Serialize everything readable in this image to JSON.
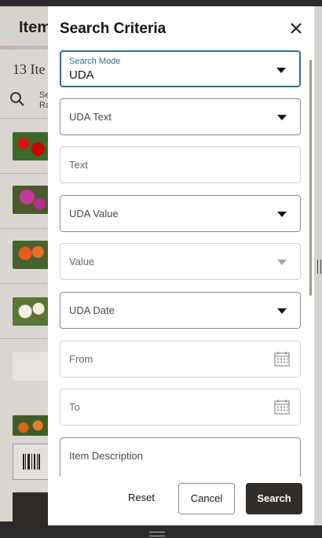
{
  "background": {
    "header_title": "Item",
    "item_count": "13 Ite",
    "search_snippet_1": "Se",
    "search_snippet_2": "Ra"
  },
  "dialog": {
    "title": "Search Criteria",
    "fields": {
      "search_mode": {
        "label": "Search Mode",
        "value": "UDA"
      },
      "uda_text": {
        "label": "UDA Text"
      },
      "text": {
        "label": "Text"
      },
      "uda_value": {
        "label": "UDA Value"
      },
      "value": {
        "label": "Value"
      },
      "uda_date": {
        "label": "UDA Date"
      },
      "from": {
        "label": "From"
      },
      "to": {
        "label": "To"
      },
      "item_description": {
        "label": "Item Description"
      }
    },
    "buttons": {
      "reset": "Reset",
      "cancel": "Cancel",
      "search": "Search"
    }
  },
  "colors": {
    "accent": "#2f6f8f",
    "primary_button": "#312d2a"
  },
  "icons": [
    "close-icon",
    "search-icon",
    "chevron-down-icon",
    "calendar-icon",
    "barcode-icon"
  ]
}
